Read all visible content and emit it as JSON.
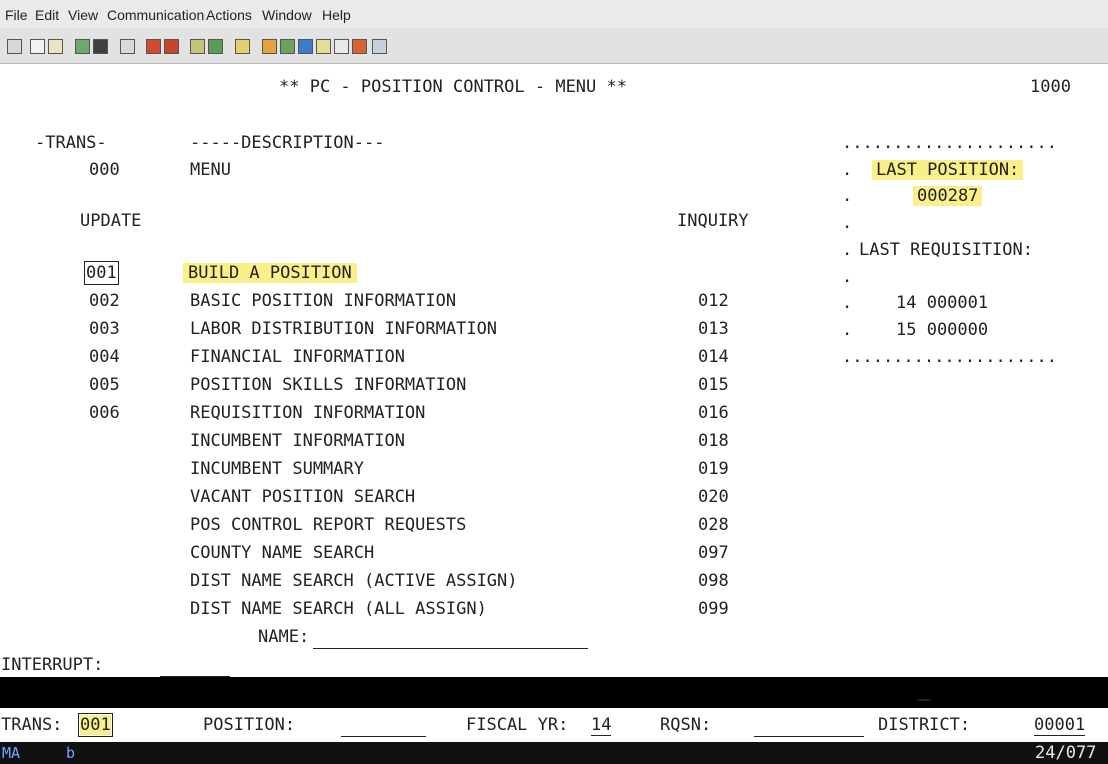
{
  "menubar": [
    "File",
    "Edit",
    "View",
    "Communication",
    "Actions",
    "Window",
    "Help"
  ],
  "screen": {
    "title": "** PC - POSITION CONTROL - MENU **",
    "screen_id": "1000",
    "trans_header": "-TRANS-",
    "desc_header": "-----DESCRIPTION---",
    "menu_code": "000",
    "menu_label": "MENU",
    "update_header": "UPDATE",
    "inquiry_header": "INQUIRY",
    "rows": [
      {
        "update": "001",
        "desc": "BUILD A POSITION",
        "inquiry": ""
      },
      {
        "update": "002",
        "desc": "BASIC POSITION INFORMATION",
        "inquiry": "012"
      },
      {
        "update": "003",
        "desc": "LABOR DISTRIBUTION INFORMATION",
        "inquiry": "013"
      },
      {
        "update": "004",
        "desc": "FINANCIAL INFORMATION",
        "inquiry": "014"
      },
      {
        "update": "005",
        "desc": "POSITION SKILLS INFORMATION",
        "inquiry": "015"
      },
      {
        "update": "006",
        "desc": "REQUISITION INFORMATION",
        "inquiry": "016"
      },
      {
        "update": "",
        "desc": "INCUMBENT INFORMATION",
        "inquiry": "018"
      },
      {
        "update": "",
        "desc": "INCUMBENT SUMMARY",
        "inquiry": "019"
      },
      {
        "update": "",
        "desc": "VACANT POSITION SEARCH",
        "inquiry": "020"
      },
      {
        "update": "",
        "desc": "POS CONTROL REPORT REQUESTS",
        "inquiry": "028"
      },
      {
        "update": "",
        "desc": "COUNTY NAME SEARCH",
        "inquiry": "097"
      },
      {
        "update": "",
        "desc": "DIST NAME SEARCH (ACTIVE ASSIGN)",
        "inquiry": "098"
      },
      {
        "update": "",
        "desc": "DIST NAME SEARCH (ALL ASSIGN)",
        "inquiry": "099"
      }
    ],
    "name_label": "NAME:",
    "interrupt_label": "INTERRUPT:",
    "side": {
      "dots": ".....................",
      "last_position_label": "LAST POSITION:",
      "last_position_value": "000287",
      "last_requisition_label": "LAST REQUISITION:",
      "req_line1": "14 000001",
      "req_line2": "15 000000"
    }
  },
  "keyline": {
    "trans_label": "TRANS:",
    "trans_value": "001",
    "position_label": "POSITION:",
    "fiscal_label": "FISCAL YR:",
    "fiscal_value": "14",
    "rqsn_label": "RQSN:",
    "district_label": "DISTRICT:",
    "district_value": "00001"
  },
  "oia": {
    "session": "MA",
    "mode": "b",
    "cursor": "24/077"
  },
  "colors": {
    "highlight": "#faf08a",
    "oia_session": "#6ea8ff"
  }
}
